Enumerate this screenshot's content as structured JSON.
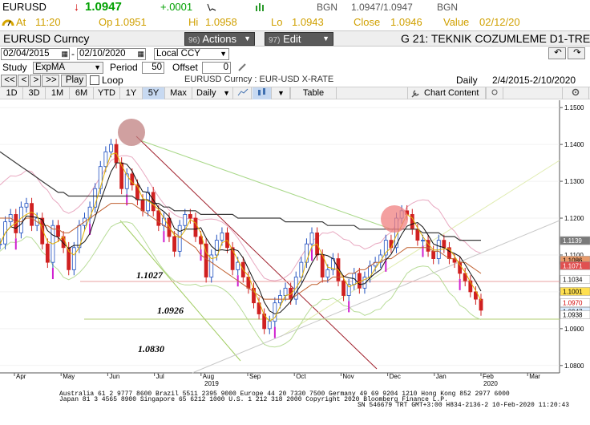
{
  "quote": {
    "ticker": "EURUSD",
    "arrow": "↓",
    "last": "1.0947",
    "change": "+.0001",
    "bgn_label": "BGN",
    "bid_ask": "1.0947/1.0947",
    "bgn_label2": "BGN",
    "at_label": "At",
    "at_time": "11:20",
    "op_label": "Op",
    "op_value": "1.0951",
    "hi_label": "Hi",
    "hi_value": "1.0958",
    "lo_label": "Lo",
    "lo_value": "1.0943",
    "close_label": "Close",
    "close_value": "1.0946",
    "value_label": "Value",
    "value_date": "02/12/20"
  },
  "titlebar": {
    "security": "EURUSD  Curncy",
    "actions_num": "96)",
    "actions_label": "Actions",
    "edit_num": "97)",
    "edit_label": "Edit",
    "page_title": "G 21: TEKNIK COZUMLEME D1-TRE"
  },
  "dates": {
    "start": "02/04/2015",
    "end": "02/10/2020",
    "currency": "Local CCY"
  },
  "study": {
    "study_label": "Study",
    "study_value": "ExpMA",
    "period_label": "Period",
    "period_value": "50",
    "offset_label": "Offset",
    "offset_value": "0"
  },
  "play": {
    "btn1": "<<",
    "btn2": "<",
    "btn3": ">",
    "btn4": ">>",
    "play": "Play",
    "loop": "Loop",
    "desc": "EURUSD  Curncy : EUR-USD X-RATE",
    "freq": "Daily",
    "range": "2/4/2015-2/10/2020"
  },
  "toolbar": {
    "periods": [
      "1D",
      "3D",
      "1M",
      "6M",
      "YTD",
      "1Y",
      "5Y",
      "Max"
    ],
    "selected_period": "5Y",
    "frequency": "Daily",
    "table": "Table",
    "chart_content": "Chart Content",
    "colors": {
      "selected": "#c7d9f1"
    }
  },
  "chart_data": {
    "type": "line",
    "yaxis_ticks": [
      "1.1500",
      "1.1400",
      "1.1300",
      "1.1200",
      "1.1100",
      "1.1000",
      "1.0900",
      "1.0800"
    ],
    "xaxis_labels": [
      "Apr",
      "May",
      "Jun",
      "Jul",
      "Aug",
      "Sep",
      "Oct",
      "Nov",
      "Dec",
      "Jan",
      "Feb",
      "Mar"
    ],
    "xaxis_years": [
      "2019",
      "2020"
    ],
    "ylim": [
      1.078,
      1.152
    ],
    "annotations": [
      "1.1027",
      "1.0926",
      "1.0830"
    ],
    "price_labels": [
      {
        "value": "1.1139",
        "color": "#7a7a7a",
        "text_color": "#ffffff"
      },
      {
        "value": "1.1086",
        "color": "#e89a6a",
        "text_color": "#000000"
      },
      {
        "value": "1.1071",
        "color": "#e05050",
        "text_color": "#ffffff"
      },
      {
        "value": "1.1034",
        "color": "#ffffff",
        "text_color": "#000000"
      },
      {
        "value": "1.1001",
        "color": "#ffe050",
        "text_color": "#000000"
      },
      {
        "value": "1.0970",
        "color": "#ffffff",
        "text_color": "#d00000"
      },
      {
        "value": "1.0947",
        "color": "#d9ecff",
        "text_color": "#000000"
      },
      {
        "value": "1.0938",
        "color": "#ffffff",
        "text_color": "#000000"
      }
    ],
    "close": [
      1.113,
      1.119,
      1.121,
      1.116,
      1.123,
      1.124,
      1.118,
      1.12,
      1.113,
      1.108,
      1.118,
      1.115,
      1.112,
      1.106,
      1.112,
      1.118,
      1.12,
      1.123,
      1.128,
      1.134,
      1.138,
      1.14,
      1.135,
      1.128,
      1.132,
      1.129,
      1.125,
      1.122,
      1.127,
      1.122,
      1.118,
      1.12,
      1.115,
      1.111,
      1.118,
      1.121,
      1.12,
      1.115,
      1.113,
      1.104,
      1.11,
      1.114,
      1.116,
      1.112,
      1.106,
      1.108,
      1.104,
      1.101,
      1.097,
      1.094,
      1.09,
      1.092,
      1.097,
      1.099,
      1.101,
      1.098,
      1.104,
      1.108,
      1.113,
      1.116,
      1.11,
      1.104,
      1.106,
      1.109,
      1.103,
      1.099,
      1.102,
      1.105,
      1.101,
      1.104,
      1.107,
      1.108,
      1.11,
      1.114,
      1.112,
      1.12,
      1.122,
      1.121,
      1.117,
      1.114,
      1.114,
      1.111,
      1.109,
      1.114,
      1.112,
      1.109,
      1.108,
      1.105,
      1.103,
      1.1,
      1.098,
      1.095
    ],
    "ema50": [
      1.12,
      1.12,
      1.12,
      1.119,
      1.119,
      1.12,
      1.12,
      1.119,
      1.118,
      1.118,
      1.117,
      1.117,
      1.116,
      1.116,
      1.117,
      1.118,
      1.119,
      1.12,
      1.121,
      1.122,
      1.123,
      1.124,
      1.124,
      1.124,
      1.124,
      1.124,
      1.123,
      1.122,
      1.121,
      1.12,
      1.119,
      1.118,
      1.117,
      1.116,
      1.115,
      1.114,
      1.113,
      1.112,
      1.11,
      1.109,
      1.108,
      1.107,
      1.106,
      1.105,
      1.104,
      1.103,
      1.102,
      1.101,
      1.1,
      1.099,
      1.098,
      1.098,
      1.098,
      1.098,
      1.098,
      1.098,
      1.099,
      1.1,
      1.101,
      1.102,
      1.102,
      1.103,
      1.103,
      1.104,
      1.104,
      1.104,
      1.105,
      1.105,
      1.106,
      1.106,
      1.107,
      1.108,
      1.108,
      1.109,
      1.109,
      1.11,
      1.111,
      1.112,
      1.112,
      1.112,
      1.112,
      1.112,
      1.111,
      1.111,
      1.11,
      1.109,
      1.109,
      1.108,
      1.108,
      1.107,
      1.106,
      1.105
    ],
    "sma200": [
      1.138,
      1.137,
      1.136,
      1.135,
      1.134,
      1.133,
      1.132,
      1.131,
      1.13,
      1.129,
      1.128,
      1.127,
      1.127,
      1.126,
      1.126,
      1.126,
      1.126,
      1.126,
      1.126,
      1.126,
      1.126,
      1.126,
      1.126,
      1.126,
      1.126,
      1.126,
      1.125,
      1.125,
      1.125,
      1.124,
      1.124,
      1.123,
      1.123,
      1.122,
      1.122,
      1.122,
      1.122,
      1.122,
      1.121,
      1.121,
      1.121,
      1.121,
      1.121,
      1.121,
      1.121,
      1.12,
      1.12,
      1.12,
      1.12,
      1.12,
      1.12,
      1.12,
      1.12,
      1.12,
      1.119,
      1.119,
      1.119,
      1.119,
      1.119,
      1.119,
      1.119,
      1.119,
      1.118,
      1.118,
      1.118,
      1.118,
      1.118,
      1.118,
      1.117,
      1.117,
      1.117,
      1.117,
      1.117,
      1.117,
      1.117,
      1.117,
      1.117,
      1.117,
      1.117,
      1.117,
      1.116,
      1.116,
      1.116,
      1.116,
      1.115,
      1.115,
      1.115,
      1.114,
      1.114,
      1.114,
      1.114,
      1.114
    ]
  },
  "footer": {
    "line1": "Australia 61 2 9777 8600 Brazil 5511 2395 9000 Europe 44 20 7330 7500 Germany 49 69 9204 1210 Hong Kong 852 2977 6000",
    "line2": "Japan 81 3 4565 8900        Singapore 65 6212 1000      U.S. 1 212 318 2000          Copyright 2020 Bloomberg Finance L.P.",
    "line3": "SN 546679 TRT  GMT+3:00 H834-2136-2 10-Feb-2020 11:20:43"
  }
}
